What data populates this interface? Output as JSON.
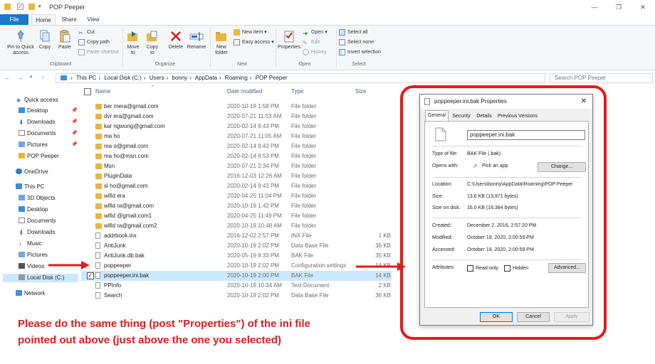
{
  "window": {
    "title": "POP Peeper"
  },
  "ribbon_tabs": [
    "File",
    "Home",
    "Share",
    "View"
  ],
  "ribbon": {
    "clipboard": {
      "pin_label": "Pin to Quick access",
      "copy_label": "Copy",
      "paste_label": "Paste",
      "cut_label": "Cut",
      "copy_path_label": "Copy path",
      "paste_shortcut_label": "Paste shortcut",
      "group_label": "Clipboard"
    },
    "organize": {
      "move_label": "Move to",
      "copy_to_label": "Copy to",
      "delete_label": "Delete",
      "rename_label": "Rename",
      "group_label": "Organize"
    },
    "new": {
      "folder_label": "New folder",
      "item_label": "New item",
      "easy_label": "Easy access",
      "group_label": "New"
    },
    "open": {
      "properties_label": "Properties",
      "open_label": "Open",
      "edit_label": "Edit",
      "history_label": "History",
      "group_label": "Open"
    },
    "select": {
      "all_label": "Select all",
      "none_label": "Select none",
      "invert_label": "Invert selection",
      "group_label": "Select"
    }
  },
  "address": {
    "crumbs": [
      "This PC",
      "Local Disk (C:)",
      "Users",
      "bonny",
      "AppData",
      "Roaming",
      "POP Peeper"
    ],
    "search_placeholder": "Search POP Peeper"
  },
  "nav": {
    "quick_access": "Quick access",
    "items": [
      "Desktop",
      "Downloads",
      "Documents",
      "Pictures",
      "POP Peeper"
    ],
    "onedrive": "OneDrive",
    "this_pc": "This PC",
    "pc_items": [
      "3D Objects",
      "Desktop",
      "Documents",
      "Downloads",
      "Music",
      "Pictures",
      "Videos",
      "Local Disk (C:)"
    ],
    "network": "Network"
  },
  "columns": {
    "name": "Name",
    "date": "Date modified",
    "type": "Type",
    "size": "Size"
  },
  "files": [
    {
      "name": "ber      mera@gmail.com",
      "date": "2020-10-19 1:58 PM",
      "type": "File folder",
      "size": "",
      "kind": "folder"
    },
    {
      "name": "dvr     era@gmail.com",
      "date": "2020-07-21 11:53 AM",
      "type": "File folder",
      "size": "",
      "kind": "folder"
    },
    {
      "name": "kar       ngwong@gmail.com",
      "date": "2020-02-14 9:43 PM",
      "type": "File folder",
      "size": "",
      "kind": "folder"
    },
    {
      "name": "ma    ho",
      "date": "2020-07-21 11:05 AM",
      "type": "File folder",
      "size": "",
      "kind": "folder"
    },
    {
      "name": "ma    o@gmail.com",
      "date": "2020-02-14 9:43 PM",
      "type": "File folder",
      "size": "",
      "kind": "folder"
    },
    {
      "name": "ma    ho@msn.com",
      "date": "2020-02-14 9:53 PM",
      "type": "File folder",
      "size": "",
      "kind": "folder"
    },
    {
      "name": "Msn",
      "date": "2020-07-21 2:34 PM",
      "type": "File folder",
      "size": "",
      "kind": "folder"
    },
    {
      "name": "PluginData",
      "date": "2016-12-03 12:26 AM",
      "type": "File folder",
      "size": "",
      "kind": "folder"
    },
    {
      "name": "sl    ho@gmail.com",
      "date": "2020-02-14 9:43 PM",
      "type": "File folder",
      "size": "",
      "kind": "folder"
    },
    {
      "name": "wifid      era",
      "date": "2020-04-25 11:04 PM",
      "type": "File folder",
      "size": "",
      "kind": "folder"
    },
    {
      "name": "wifid      ra@gmail.com",
      "date": "2020-10-19 1:42 PM",
      "type": "File folder",
      "size": "",
      "kind": "folder"
    },
    {
      "name": "wifid      @gmail.com1",
      "date": "2020-04-25 11:49 PM",
      "type": "File folder",
      "size": "",
      "kind": "folder"
    },
    {
      "name": "wifid      ra@gmail.com2",
      "date": "2020-10-19 10:48 AM",
      "type": "File folder",
      "size": "",
      "kind": "folder"
    },
    {
      "name": "addrbook.inx",
      "date": "2016-12-02 2:57 PM",
      "type": "INX File",
      "size": "1 KB",
      "kind": "file"
    },
    {
      "name": "AntiJunk",
      "date": "2020-10-19 2:02 PM",
      "type": "Data Base File",
      "size": "36 KB",
      "kind": "file"
    },
    {
      "name": "AntiJunk.db.bak",
      "date": "2020-05-19 8:33 PM",
      "type": "BAK File",
      "size": "35 KB",
      "kind": "file"
    },
    {
      "name": "poppeeper",
      "date": "2020-10-19 2:02 PM",
      "type": "Configuration settings",
      "size": "14 KB",
      "kind": "file"
    },
    {
      "name": "poppeeper.ini.bak",
      "date": "2020-10-19 2:00 PM",
      "type": "BAK File",
      "size": "14 KB",
      "kind": "file"
    },
    {
      "name": "PPInfo",
      "date": "2020-10-19 10:34 AM",
      "type": "Text Document",
      "size": "2 KB",
      "kind": "file"
    },
    {
      "name": "Search",
      "date": "2020-10-19 2:02 PM",
      "type": "Data Base File",
      "size": "36 KB",
      "kind": "file"
    }
  ],
  "selected_row": 17,
  "annotation": {
    "line1": "Please do the same thing (post \"Properties\") of the ini file",
    "line2": "pointed out above (just above the one you selected)",
    "color": "#e31b1b"
  },
  "dialog": {
    "title": "poppeeper.ini.bak Properties",
    "tabs": [
      "General",
      "Security",
      "Details",
      "Previous Versions"
    ],
    "filename": "poppeeper.ini.bak",
    "type_label": "Type of file:",
    "type_value": "BAK File (.bak)",
    "opens_label": "Opens with:",
    "opens_value": "Pick an app",
    "change_button": "Change...",
    "location_label": "Location:",
    "location_value": "C:\\Users\\bonny\\AppData\\Roaming\\POP Peeper",
    "size_label": "Size:",
    "size_value": "13.6 KB (13,971 bytes)",
    "disk_label": "Size on disk:",
    "disk_value": "16.0 KB (16,384 bytes)",
    "created_label": "Created:",
    "created_value": "December 2, 2016, 2:57:20 PM",
    "modified_label": "Modified:",
    "modified_value": "October 19, 2020, 2:00:59 PM",
    "accessed_label": "Accessed:",
    "accessed_value": "October 19, 2020, 2:00:59 PM",
    "attributes_label": "Attributes:",
    "readonly_label": "Read-only",
    "hidden_label": "Hidden",
    "advanced_button": "Advanced...",
    "ok_button": "OK",
    "cancel_button": "Cancel",
    "apply_button": "Apply"
  }
}
